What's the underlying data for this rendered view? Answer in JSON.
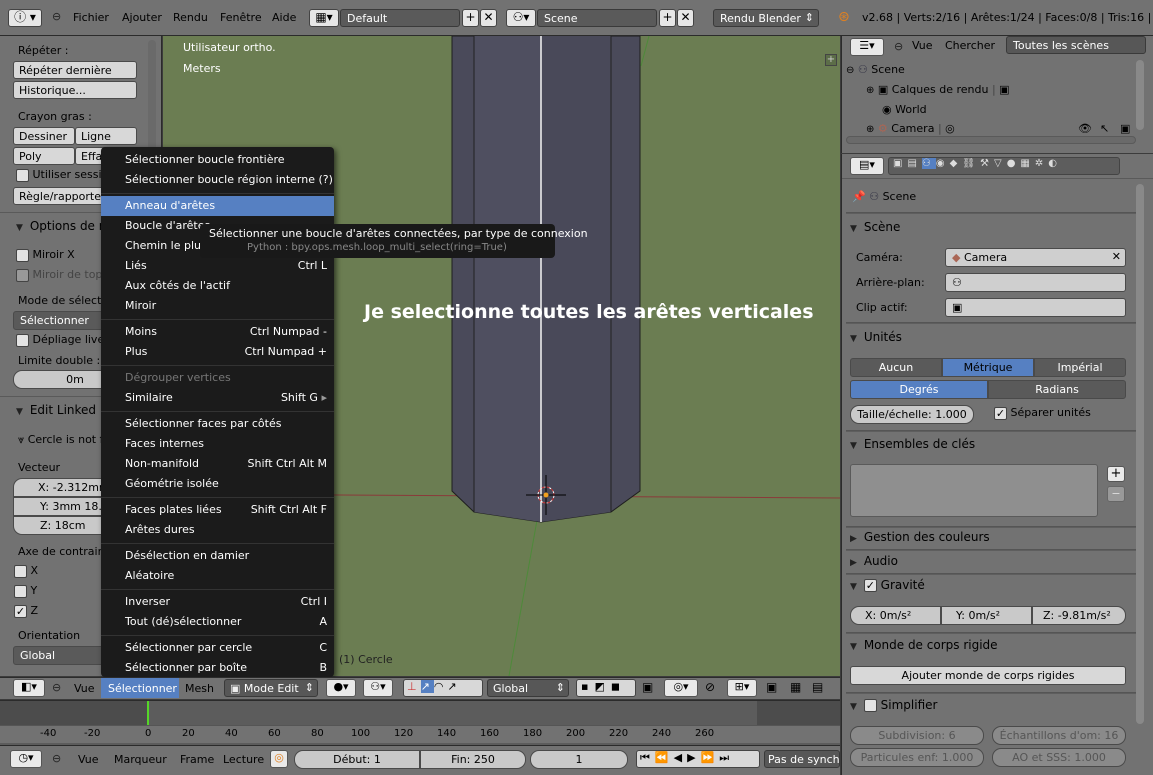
{
  "topbar": {
    "menus": [
      "Fichier",
      "Ajouter",
      "Rendu",
      "Fenêtre",
      "Aide"
    ],
    "layout": "Default",
    "scene": "Scene",
    "engine": "Rendu Blender",
    "stats": "v2.68 | Verts:2/16 | Arêtes:1/24 | Faces:0/8 | Tris:16 | Ob"
  },
  "shelf": {
    "repeat_title": "Répéter :",
    "repeat_last": "Répéter dernière",
    "history": "Historique...",
    "grease_title": "Crayon gras :",
    "draw": "Dessiner",
    "line": "Ligne",
    "poly": "Poly",
    "erase": "Effac",
    "use_sessions": "Utiliser sessio",
    "ruler": "Règle/rapporteur",
    "options_panel": "Options de m",
    "mirror_x": "Miroir X",
    "mirror_topo": "Miroir de topo",
    "select_mode_label": "Mode de sélection",
    "select_mode": "Sélectionner",
    "unwrap_live": "Dépliage live",
    "double_limit": "Limite double : 0",
    "double_value": "0m",
    "edit_linked": "Edit Linked Li",
    "circle_warning": "Cercle is not f",
    "vector_label": "Vecteur",
    "vec_x": "X: -2.312mm",
    "vec_y": "Y: 3mm 18.0",
    "vec_z": "Z: 18cm",
    "constraint_label": "Axe de contrainte",
    "ax_x": "X",
    "ax_y": "Y",
    "ax_z": "Z",
    "orientation_label": "Orientation",
    "orientation": "Global"
  },
  "viewport": {
    "view_label": "Utilisateur ortho.",
    "units_label": "Meters",
    "annotation": "Je selectionne toutes les arêtes verticales",
    "object_label": "(1) Cercle"
  },
  "menu": {
    "items": [
      {
        "label": "Sélectionner boucle frontière",
        "shortcut": ""
      },
      {
        "label": "Sélectionner boucle région interne (?)",
        "shortcut": ""
      },
      {
        "label": "Anneau d'arêtes",
        "shortcut": ""
      },
      {
        "label": "Boucle d'arêtes",
        "shortcut": ""
      },
      {
        "label": "Chemin le plus court",
        "shortcut": ""
      },
      {
        "label": "Liés",
        "shortcut": "Ctrl L"
      },
      {
        "label": "Aux côtés de l'actif",
        "shortcut": ""
      },
      {
        "label": "Miroir",
        "shortcut": ""
      },
      {
        "label": "Moins",
        "shortcut": "Ctrl Numpad -"
      },
      {
        "label": "Plus",
        "shortcut": "Ctrl Numpad +"
      },
      {
        "label": "Dégrouper vertices",
        "shortcut": ""
      },
      {
        "label": "Similaire",
        "shortcut": "Shift G"
      },
      {
        "label": "Sélectionner faces par côtés",
        "shortcut": ""
      },
      {
        "label": "Faces internes",
        "shortcut": ""
      },
      {
        "label": "Non-manifold",
        "shortcut": "Shift Ctrl Alt M"
      },
      {
        "label": "Géométrie isolée",
        "shortcut": ""
      },
      {
        "label": "Faces plates liées",
        "shortcut": "Shift Ctrl Alt F"
      },
      {
        "label": "Arêtes dures",
        "shortcut": ""
      },
      {
        "label": "Désélection en damier",
        "shortcut": ""
      },
      {
        "label": "Aléatoire",
        "shortcut": ""
      },
      {
        "label": "Inverser",
        "shortcut": "Ctrl I"
      },
      {
        "label": "Tout (dé)sélectionner",
        "shortcut": "A"
      },
      {
        "label": "Sélectionner par cercle",
        "shortcut": "C"
      },
      {
        "label": "Sélectionner par boîte",
        "shortcut": "B"
      }
    ]
  },
  "tooltip": {
    "text": "Sélectionner une boucle d'arêtes connectées, par type de connexion",
    "python": "Python : bpy.ops.mesh.loop_multi_select(ring=True)"
  },
  "outliner": {
    "view": "Vue",
    "search": "Chercher",
    "filter": "Toutes les scènes",
    "rows": [
      "Scene",
      "Calques de rendu",
      "World",
      "Camera"
    ]
  },
  "props": {
    "context": "Scene",
    "scene_panel": "Scène",
    "camera_label": "Caméra:",
    "camera_value": "Camera",
    "background_label": "Arrière-plan:",
    "clip_label": "Clip actif:",
    "units_panel": "Unités",
    "unit_none": "Aucun",
    "unit_metric": "Métrique",
    "unit_imperial": "Impérial",
    "degrees": "Degrés",
    "radians": "Radians",
    "scale": "Taille/échelle: 1.000",
    "separate_units": "Séparer unités",
    "keying_panel": "Ensembles de clés",
    "color_panel": "Gestion des couleurs",
    "audio_panel": "Audio",
    "gravity_panel": "Gravité",
    "grav_x": "X: 0m/s²",
    "grav_y": "Y: 0m/s²",
    "grav_z": "Z: -9.81m/s²",
    "rigid_panel": "Monde de corps rigide",
    "rigid_add": "Ajouter monde de corps rigides",
    "simplify_panel": "Simplifier",
    "subdiv": "Subdivision: 6",
    "ao_samples": "Échantillons d'om: 16",
    "particles": "Particules enf: 1.000",
    "ao_sss": "AO et SSS: 1.000"
  },
  "vpheader": {
    "view": "Vue",
    "select": "Sélectionner",
    "mesh": "Mesh",
    "mode": "Mode Edit",
    "orientation": "Global"
  },
  "timeline": {
    "ticks": [
      "-40",
      "-20",
      "0",
      "20",
      "40",
      "60",
      "80",
      "100",
      "120",
      "140",
      "160",
      "180",
      "200",
      "220",
      "240",
      "260"
    ]
  },
  "tlheader": {
    "view": "Vue",
    "marker": "Marqueur",
    "frame": "Frame",
    "playback": "Lecture",
    "start": "Début: 1",
    "end": "Fin: 250",
    "current": "1",
    "sync": "Pas de synchro"
  },
  "colors": {
    "viewport_bg": "#6b7d52",
    "highlight": "#5680c2",
    "panel_bg": "#727272"
  }
}
